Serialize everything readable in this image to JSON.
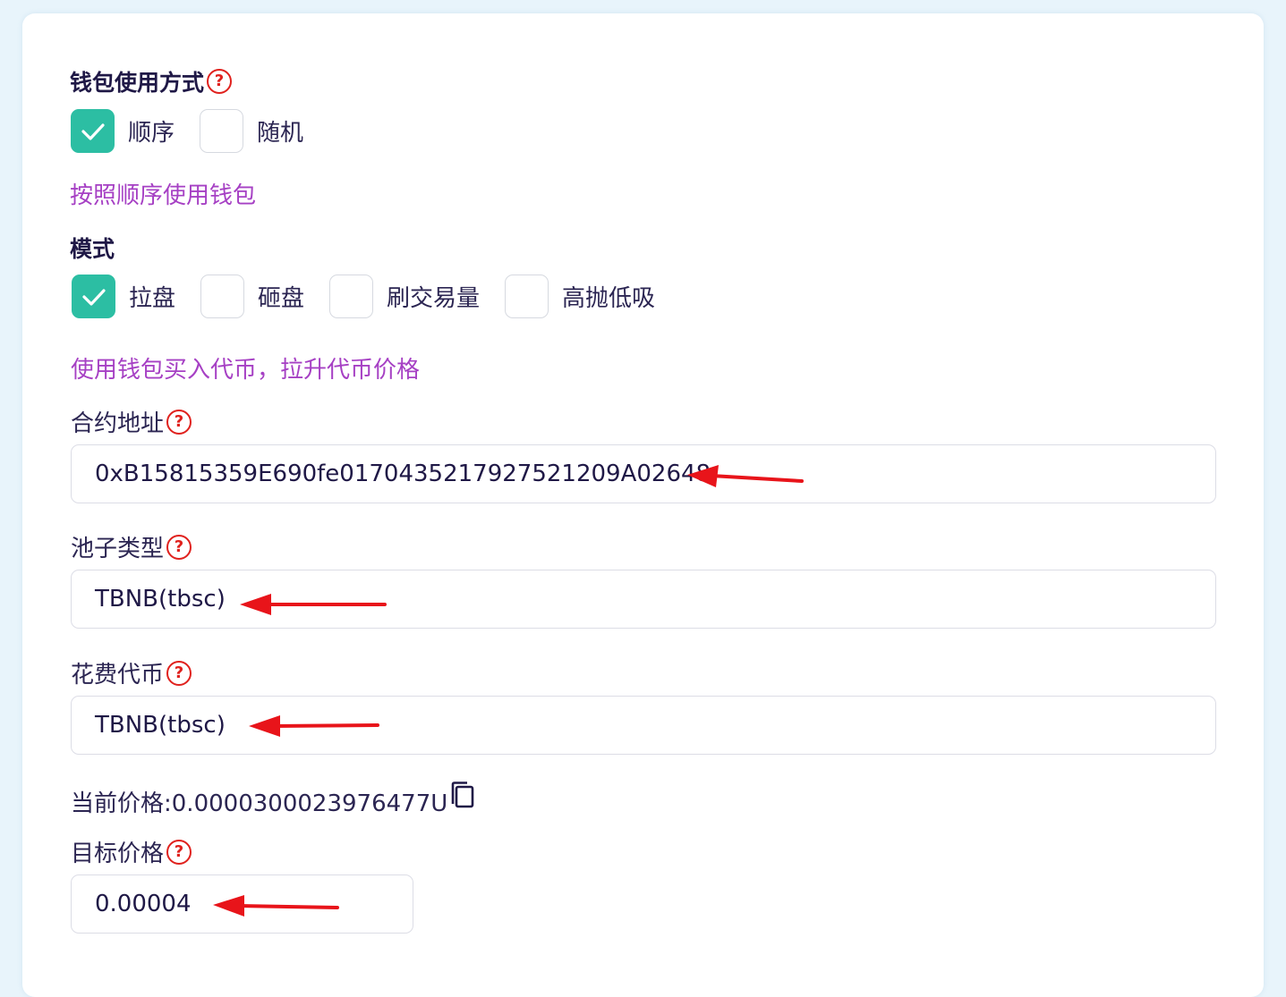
{
  "wallet_usage": {
    "title": "钱包使用方式",
    "help_icon": "question-circle-icon",
    "options": [
      {
        "label": "顺序",
        "checked": true
      },
      {
        "label": "随机",
        "checked": false
      }
    ],
    "hint": "按照顺序使用钱包"
  },
  "mode": {
    "title": "模式",
    "options": [
      {
        "label": "拉盘",
        "checked": true
      },
      {
        "label": "砸盘",
        "checked": false
      },
      {
        "label": "刷交易量",
        "checked": false
      },
      {
        "label": "高抛低吸",
        "checked": false
      }
    ],
    "hint": "使用钱包买入代币，拉升代币价格"
  },
  "contract_address": {
    "label": "合约地址",
    "value": "0xB15815359E690fe0170435217927521209A02648"
  },
  "pool_type": {
    "label": "池子类型",
    "value": "TBNB(tbsc)"
  },
  "spend_token": {
    "label": "花费代币",
    "value": "TBNB(tbsc)"
  },
  "current_price": {
    "text": "当前价格:0.0000300023976477U",
    "copy_icon": "copy-icon"
  },
  "target_price": {
    "label": "目标价格",
    "value": "0.00004"
  },
  "colors": {
    "accent": "#2cbea3",
    "hint": "#a640c4",
    "help": "#e0211d",
    "annotation_arrow": "#e8141a"
  }
}
